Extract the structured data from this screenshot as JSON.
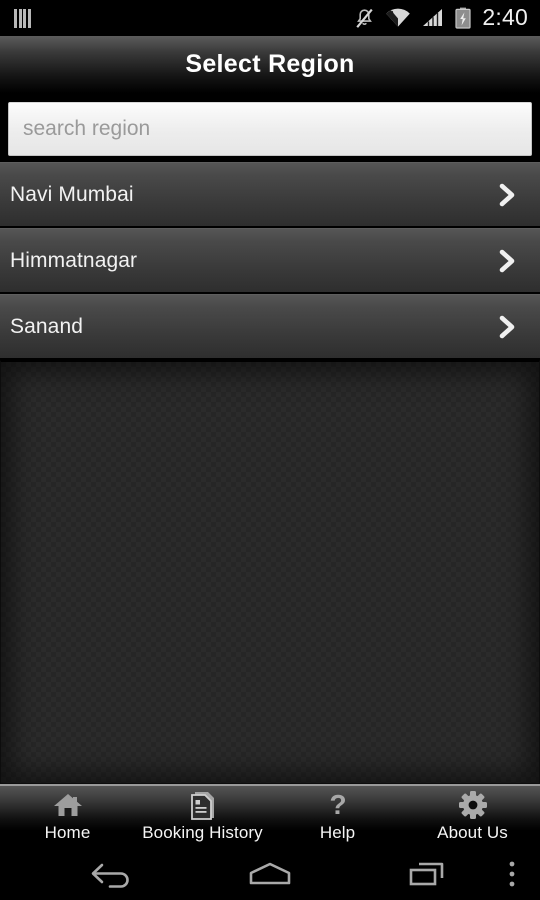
{
  "status_bar": {
    "sim_icon": "sim-bars-icon",
    "mute_icon": "mute-bell-icon",
    "wifi_icon": "wifi-icon",
    "signal_icon": "signal-bars-icon",
    "battery_icon": "battery-charging-icon",
    "time": "2:40"
  },
  "title_bar": {
    "title": "Select Region"
  },
  "search": {
    "value": "",
    "placeholder": "search region"
  },
  "regions": [
    {
      "label": "Navi Mumbai",
      "chevron": "chevron-right-icon"
    },
    {
      "label": "Himmatnagar",
      "chevron": "chevron-right-icon"
    },
    {
      "label": "Sanand",
      "chevron": "chevron-right-icon"
    }
  ],
  "tab_bar": {
    "items": [
      {
        "label": "Home",
        "icon": "home-icon"
      },
      {
        "label": "Booking History",
        "icon": "document-icon"
      },
      {
        "label": "Help",
        "icon": "question-mark-icon"
      },
      {
        "label": "About Us",
        "icon": "gear-icon"
      }
    ]
  },
  "nav_bar": {
    "back": "back-arrow-icon",
    "home": "home-pentagon-icon",
    "recents": "recents-icon",
    "menu": "overflow-menu-icon"
  },
  "colors": {
    "accent_text": "#ffffff",
    "row_text": "#f2f2f2",
    "placeholder": "#9a9a9a",
    "icon_gray": "#b8b8b8",
    "background": "#000000"
  }
}
